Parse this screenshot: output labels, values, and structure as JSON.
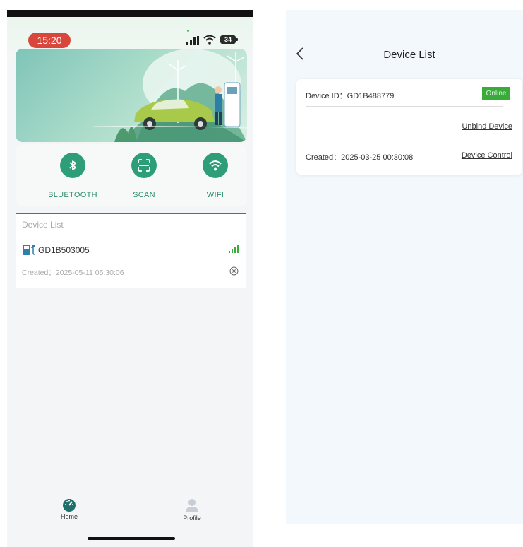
{
  "left_screen": {
    "status_bar": {
      "time": "15:20",
      "battery": "34"
    },
    "actions": [
      {
        "label": "BLUETOOTH",
        "icon": "bluetooth-icon"
      },
      {
        "label": "SCAN",
        "icon": "scan-icon"
      },
      {
        "label": "WIFI",
        "icon": "wifi-icon"
      }
    ],
    "device_list": {
      "title": "Device List",
      "device_name": "GD1B503005",
      "created": "Created：2025-05-11 05:30:06"
    },
    "tabbar": {
      "home_label": "Home",
      "profile_label": "Profile"
    }
  },
  "right_screen": {
    "title": "Device List",
    "device_id": "Device ID：GD1B488779",
    "status": "Online",
    "unbind_label": "Unbind Device",
    "created": "Created：2025-03-25 00:30:08",
    "control_label": "Device Control"
  },
  "colors": {
    "accent_green": "#2e9e78",
    "highlight_red": "#d9363e",
    "online_green": "#3aaa3a",
    "time_pill_red": "#d9463b"
  }
}
